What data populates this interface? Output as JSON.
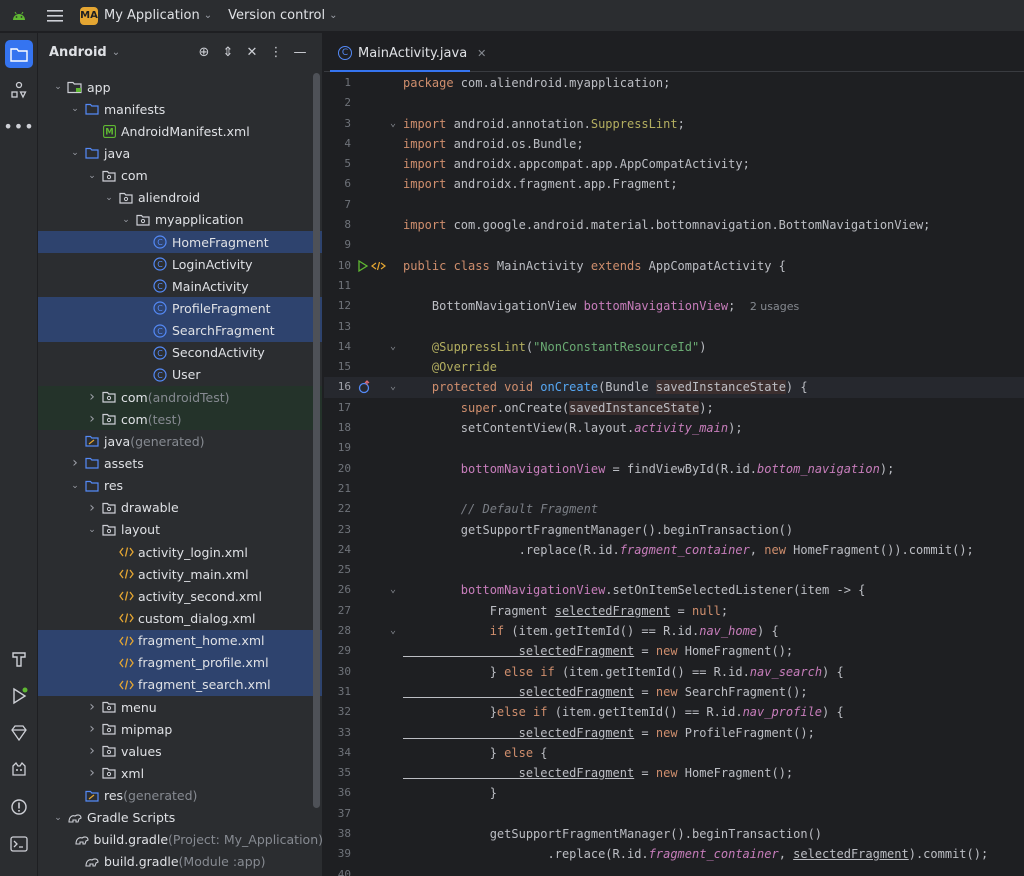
{
  "titlebar": {
    "project_badge": "MA",
    "project_name": "My Application",
    "vcs_label": "Version control"
  },
  "project_panel": {
    "view_label": "Android",
    "tree": [
      {
        "label": "app",
        "depth": 0,
        "arrow": "down",
        "icon": "module-folder-icon",
        "bold": false
      },
      {
        "label": "manifests",
        "depth": 1,
        "arrow": "down",
        "icon": "folder-icon"
      },
      {
        "label": "AndroidManifest.xml",
        "depth": 2,
        "arrow": "",
        "icon": "manifest-icon"
      },
      {
        "label": "java",
        "depth": 1,
        "arrow": "down",
        "icon": "folder-icon"
      },
      {
        "label": "com",
        "depth": 2,
        "arrow": "down",
        "icon": "package-icon"
      },
      {
        "label": "aliendroid",
        "depth": 3,
        "arrow": "down",
        "icon": "package-icon"
      },
      {
        "label": "myapplication",
        "depth": 4,
        "arrow": "down",
        "icon": "package-icon"
      },
      {
        "label": "HomeFragment",
        "depth": 5,
        "arrow": "",
        "icon": "class-icon",
        "selected": true
      },
      {
        "label": "LoginActivity",
        "depth": 5,
        "arrow": "",
        "icon": "class-icon"
      },
      {
        "label": "MainActivity",
        "depth": 5,
        "arrow": "",
        "icon": "class-icon"
      },
      {
        "label": "ProfileFragment",
        "depth": 5,
        "arrow": "",
        "icon": "class-icon",
        "selected": true
      },
      {
        "label": "SearchFragment",
        "depth": 5,
        "arrow": "",
        "icon": "class-icon",
        "selected": true
      },
      {
        "label": "SecondActivity",
        "depth": 5,
        "arrow": "",
        "icon": "class-icon"
      },
      {
        "label": "User",
        "depth": 5,
        "arrow": "",
        "icon": "class-icon"
      },
      {
        "label": "com",
        "suffix": "(androidTest)",
        "depth": 2,
        "arrow": "right",
        "icon": "package-icon",
        "green": true
      },
      {
        "label": "com",
        "suffix": "(test)",
        "depth": 2,
        "arrow": "right",
        "icon": "package-icon",
        "green": true
      },
      {
        "label": "java",
        "suffix": "(generated)",
        "depth": 1,
        "arrow": "",
        "icon": "generated-folder-icon"
      },
      {
        "label": "assets",
        "depth": 1,
        "arrow": "right",
        "icon": "folder-icon"
      },
      {
        "label": "res",
        "depth": 1,
        "arrow": "down",
        "icon": "folder-icon"
      },
      {
        "label": "drawable",
        "depth": 2,
        "arrow": "right",
        "icon": "package-icon"
      },
      {
        "label": "layout",
        "depth": 2,
        "arrow": "down",
        "icon": "package-icon"
      },
      {
        "label": "activity_login.xml",
        "depth": 3,
        "arrow": "",
        "icon": "xml-icon"
      },
      {
        "label": "activity_main.xml",
        "depth": 3,
        "arrow": "",
        "icon": "xml-icon"
      },
      {
        "label": "activity_second.xml",
        "depth": 3,
        "arrow": "",
        "icon": "xml-icon"
      },
      {
        "label": "custom_dialog.xml",
        "depth": 3,
        "arrow": "",
        "icon": "xml-icon"
      },
      {
        "label": "fragment_home.xml",
        "depth": 3,
        "arrow": "",
        "icon": "xml-icon",
        "selected": true
      },
      {
        "label": "fragment_profile.xml",
        "depth": 3,
        "arrow": "",
        "icon": "xml-icon",
        "selected": true
      },
      {
        "label": "fragment_search.xml",
        "depth": 3,
        "arrow": "",
        "icon": "xml-icon",
        "selected": true
      },
      {
        "label": "menu",
        "depth": 2,
        "arrow": "right",
        "icon": "package-icon"
      },
      {
        "label": "mipmap",
        "depth": 2,
        "arrow": "right",
        "icon": "package-icon"
      },
      {
        "label": "values",
        "depth": 2,
        "arrow": "right",
        "icon": "package-icon"
      },
      {
        "label": "xml",
        "depth": 2,
        "arrow": "right",
        "icon": "package-icon"
      },
      {
        "label": "res",
        "suffix": "(generated)",
        "depth": 1,
        "arrow": "",
        "icon": "generated-folder-icon"
      },
      {
        "label": "Gradle Scripts",
        "depth": 0,
        "arrow": "down",
        "icon": "gradle-icon"
      },
      {
        "label": "build.gradle",
        "suffix": "(Project: My_Application)",
        "depth": 1,
        "arrow": "",
        "icon": "gradle-icon"
      },
      {
        "label": "build.gradle",
        "suffix": "(Module :app)",
        "depth": 1,
        "arrow": "",
        "icon": "gradle-icon"
      }
    ]
  },
  "editor": {
    "tab_label": "MainActivity.java",
    "current_line": 16,
    "lines": [
      {
        "n": "1",
        "tokens": [
          [
            "kw",
            "package "
          ],
          [
            "",
            "com.aliendroid.myapplication;"
          ]
        ]
      },
      {
        "n": "2",
        "tokens": []
      },
      {
        "n": "3",
        "fold": true,
        "tokens": [
          [
            "kw",
            "import "
          ],
          [
            "",
            "android.annotation."
          ],
          [
            "ann",
            "SuppressLint"
          ],
          [
            "",
            ";"
          ]
        ]
      },
      {
        "n": "4",
        "tokens": [
          [
            "kw",
            "import "
          ],
          [
            "",
            "android.os.Bundle;"
          ]
        ]
      },
      {
        "n": "5",
        "tokens": [
          [
            "kw",
            "import "
          ],
          [
            "",
            "androidx.appcompat.app.AppCompatActivity;"
          ]
        ]
      },
      {
        "n": "6",
        "tokens": [
          [
            "kw",
            "import "
          ],
          [
            "",
            "androidx.fragment.app.Fragment;"
          ]
        ]
      },
      {
        "n": "7",
        "tokens": []
      },
      {
        "n": "8",
        "tokens": [
          [
            "kw",
            "import "
          ],
          [
            "",
            "com.google.android.material.bottomnavigation.BottomNavigationView;"
          ]
        ]
      },
      {
        "n": "9",
        "tokens": []
      },
      {
        "n": "10",
        "gutter": "run",
        "tokens": [
          [
            "kw",
            "public class "
          ],
          [
            "",
            "MainActivity "
          ],
          [
            "kw",
            "extends "
          ],
          [
            "",
            "AppCompatActivity {"
          ]
        ]
      },
      {
        "n": "11",
        "tokens": []
      },
      {
        "n": "12",
        "tokens": [
          [
            "",
            "    BottomNavigationView "
          ],
          [
            "fld",
            "bottomNavigationView"
          ],
          [
            "",
            ";  "
          ],
          [
            "hint",
            "2 usages"
          ]
        ]
      },
      {
        "n": "13",
        "tokens": []
      },
      {
        "n": "14",
        "fold": true,
        "tokens": [
          [
            "ann",
            "    @SuppressLint"
          ],
          [
            "",
            "("
          ],
          [
            "str",
            "\"NonConstantResourceId\""
          ],
          [
            "",
            ")"
          ]
        ]
      },
      {
        "n": "15",
        "tokens": [
          [
            "ann",
            "    @Override"
          ]
        ]
      },
      {
        "n": "16",
        "gutter": "override",
        "fold": true,
        "tokens": [
          [
            "kw",
            "    protected void "
          ],
          [
            "fn",
            "onCreate"
          ],
          [
            "",
            "(Bundle "
          ],
          [
            "hl",
            "savedInstanceState"
          ],
          [
            "",
            ") {"
          ]
        ]
      },
      {
        "n": "17",
        "tokens": [
          [
            "kw",
            "        super"
          ],
          [
            "",
            ".onCreate("
          ],
          [
            "hl",
            "savedInstanceState"
          ],
          [
            "",
            ");"
          ]
        ]
      },
      {
        "n": "18",
        "tokens": [
          [
            "",
            "        setContentView(R.layout."
          ],
          [
            "ifld",
            "activity_main"
          ],
          [
            "",
            ");"
          ]
        ]
      },
      {
        "n": "19",
        "tokens": []
      },
      {
        "n": "20",
        "tokens": [
          [
            "fld",
            "        bottomNavigationView"
          ],
          [
            "",
            " = findViewById(R.id."
          ],
          [
            "ifld",
            "bottom_navigation"
          ],
          [
            "",
            ");"
          ]
        ]
      },
      {
        "n": "21",
        "tokens": []
      },
      {
        "n": "22",
        "tokens": [
          [
            "cmt",
            "        // Default Fragment"
          ]
        ]
      },
      {
        "n": "23",
        "tokens": [
          [
            "",
            "        getSupportFragmentManager().beginTransaction()"
          ]
        ]
      },
      {
        "n": "24",
        "tokens": [
          [
            "",
            "                .replace(R.id."
          ],
          [
            "ifld",
            "fragment_container"
          ],
          [
            "",
            ", "
          ],
          [
            "kw",
            "new "
          ],
          [
            "",
            "HomeFragment()).commit();"
          ]
        ]
      },
      {
        "n": "25",
        "tokens": []
      },
      {
        "n": "26",
        "fold": true,
        "tokens": [
          [
            "fld",
            "        bottomNavigationView"
          ],
          [
            "",
            ".setOnItemSelectedListener(item -> {"
          ]
        ]
      },
      {
        "n": "27",
        "tokens": [
          [
            "",
            "            Fragment "
          ],
          [
            "ul",
            "selectedFragment"
          ],
          [
            "",
            " = "
          ],
          [
            "kw",
            "null"
          ],
          [
            "",
            ";"
          ]
        ]
      },
      {
        "n": "28",
        "fold": true,
        "tokens": [
          [
            "kw",
            "            if "
          ],
          [
            "",
            "(item.getItemId() == R.id."
          ],
          [
            "ifld",
            "nav_home"
          ],
          [
            "",
            ") {"
          ]
        ]
      },
      {
        "n": "29",
        "tokens": [
          [
            "ul",
            "                selectedFragment"
          ],
          [
            "",
            " = "
          ],
          [
            "kw",
            "new "
          ],
          [
            "",
            "HomeFragment();"
          ]
        ]
      },
      {
        "n": "30",
        "tokens": [
          [
            "",
            "            } "
          ],
          [
            "kw",
            "else if "
          ],
          [
            "",
            "(item.getItemId() == R.id."
          ],
          [
            "ifld",
            "nav_search"
          ],
          [
            "",
            ") {"
          ]
        ]
      },
      {
        "n": "31",
        "tokens": [
          [
            "ul",
            "                selectedFragment"
          ],
          [
            "",
            " = "
          ],
          [
            "kw",
            "new "
          ],
          [
            "",
            "SearchFragment();"
          ]
        ]
      },
      {
        "n": "32",
        "tokens": [
          [
            "",
            "            }"
          ],
          [
            "kw",
            "else if "
          ],
          [
            "",
            "(item.getItemId() == R.id."
          ],
          [
            "ifld",
            "nav_profile"
          ],
          [
            "",
            ") {"
          ]
        ]
      },
      {
        "n": "33",
        "tokens": [
          [
            "ul",
            "                selectedFragment"
          ],
          [
            "",
            " = "
          ],
          [
            "kw",
            "new "
          ],
          [
            "",
            "ProfileFragment();"
          ]
        ]
      },
      {
        "n": "34",
        "tokens": [
          [
            "",
            "            } "
          ],
          [
            "kw",
            "else "
          ],
          [
            "",
            "{"
          ]
        ]
      },
      {
        "n": "35",
        "tokens": [
          [
            "ul",
            "                selectedFragment"
          ],
          [
            "",
            " = "
          ],
          [
            "kw",
            "new "
          ],
          [
            "",
            "HomeFragment();"
          ]
        ]
      },
      {
        "n": "36",
        "tokens": [
          [
            "",
            "            }"
          ]
        ]
      },
      {
        "n": "37",
        "tokens": []
      },
      {
        "n": "38",
        "tokens": [
          [
            "",
            "            getSupportFragmentManager().beginTransaction()"
          ]
        ]
      },
      {
        "n": "39",
        "tokens": [
          [
            "",
            "                    .replace(R.id."
          ],
          [
            "ifld",
            "fragment_container"
          ],
          [
            "",
            ", "
          ],
          [
            "ul",
            "selectedFragment"
          ],
          [
            "",
            ").commit();"
          ]
        ]
      },
      {
        "n": "40",
        "tokens": []
      }
    ]
  },
  "colors": {
    "accent": "#3574f0",
    "selection": "#2e436e",
    "keyword": "#cf8e6d",
    "method": "#56a8f5",
    "field": "#c77dbb",
    "string": "#6aab73",
    "annotation": "#b3ae60"
  }
}
